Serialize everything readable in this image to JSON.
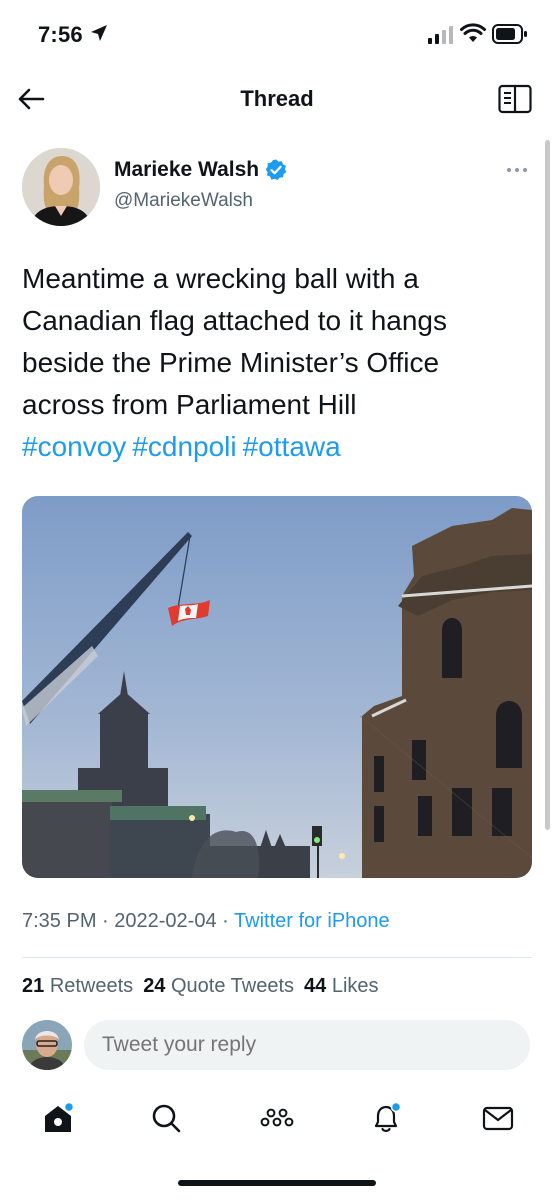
{
  "status_bar": {
    "time": "7:56"
  },
  "nav": {
    "title": "Thread"
  },
  "tweet": {
    "display_name": "Marieke Walsh",
    "handle": "@MariekeWalsh",
    "text": "Meantime a wrecking ball with a Canadian flag attached to it hangs beside the Prime Minister’s Office across from Parliament Hill",
    "hashtags": [
      "#convoy",
      "#cdnpoli",
      "#ottawa"
    ],
    "time": "7:35 PM",
    "date": "2022-02-04",
    "source": "Twitter for iPhone",
    "separator": "·",
    "retweets_count": "21",
    "retweets_label": "Retweets",
    "quotes_count": "24",
    "quotes_label": "Quote Tweets",
    "likes_count": "44",
    "likes_label": "Likes"
  },
  "reply": {
    "placeholder": "Tweet your reply"
  },
  "tabs": [
    "home-icon",
    "search-icon",
    "spaces-icon",
    "notifications-icon",
    "messages-icon"
  ],
  "colors": {
    "accent": "#1d9bf0",
    "text": "#0f1419",
    "secondary": "#536471"
  }
}
